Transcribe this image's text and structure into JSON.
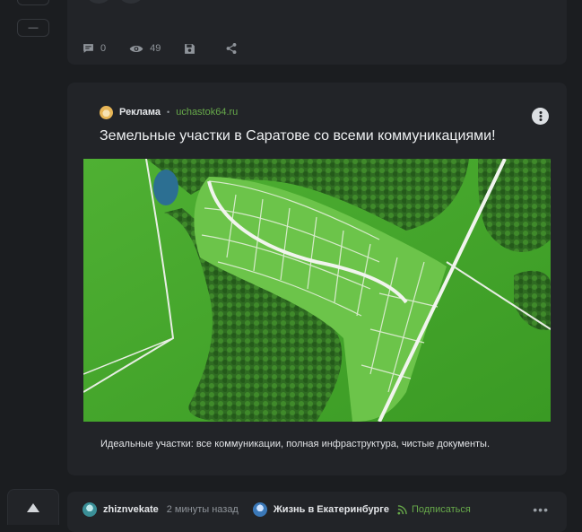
{
  "rail": {
    "top_glyph": "⌄",
    "dash_glyph": "—"
  },
  "post_stats": {
    "comments": "0",
    "views": "49"
  },
  "ad": {
    "label": "Реклама",
    "domain": "uchastok64.ru",
    "title": "Земельные участки в Саратове со всеми коммуникациями!",
    "description": "Идеальные участки: все коммуникации, полная инфраструктура, чистые документы."
  },
  "next_post": {
    "author": "zhiznvekate",
    "time": "2 минуты назад",
    "community": "Жизнь в Екатеринбурге",
    "subscribe_label": "Подписаться",
    "menu_glyph": "•••"
  },
  "colors": {
    "background": "#1b1d20",
    "card": "#222428",
    "accent_green": "#67a94a",
    "muted": "#8f949a"
  }
}
